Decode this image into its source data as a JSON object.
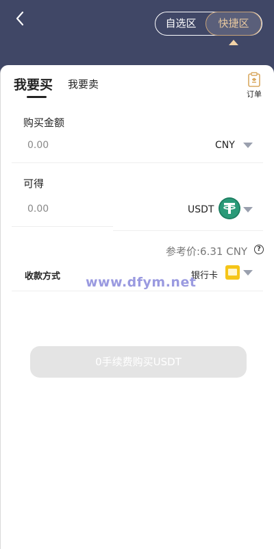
{
  "header": {
    "back_icon": "back-chevron-icon",
    "mode_tabs": [
      {
        "label": "自选区",
        "active": false
      },
      {
        "label": "快捷区",
        "active": true
      }
    ]
  },
  "tabs": [
    {
      "label": "我要买",
      "active": true
    },
    {
      "label": "我要卖",
      "active": false
    }
  ],
  "orders": {
    "label": "订单",
    "icon": "clipboard-icon"
  },
  "buy_amount": {
    "label": "购买金额",
    "placeholder": "0.00",
    "currency": "CNY"
  },
  "receive": {
    "label": "可得",
    "placeholder": "0.00",
    "currency": "USDT",
    "coin_icon": "tether-icon"
  },
  "reference_price": {
    "text": "参考价:6.31 CNY",
    "help_icon": "question-circle-icon"
  },
  "payment": {
    "label": "收款方式",
    "method": "银行卡",
    "method_icon": "bank-card-icon"
  },
  "watermark": "www.dfym.net",
  "submit": {
    "label": "0手续费购买USDT"
  },
  "colors": {
    "header_bg": "#404766",
    "accent_gold": "#e8c9a0",
    "tether_green": "#2a9a78",
    "card_yellow": "#f5c518",
    "button_disabled": "#e4e4e4"
  }
}
